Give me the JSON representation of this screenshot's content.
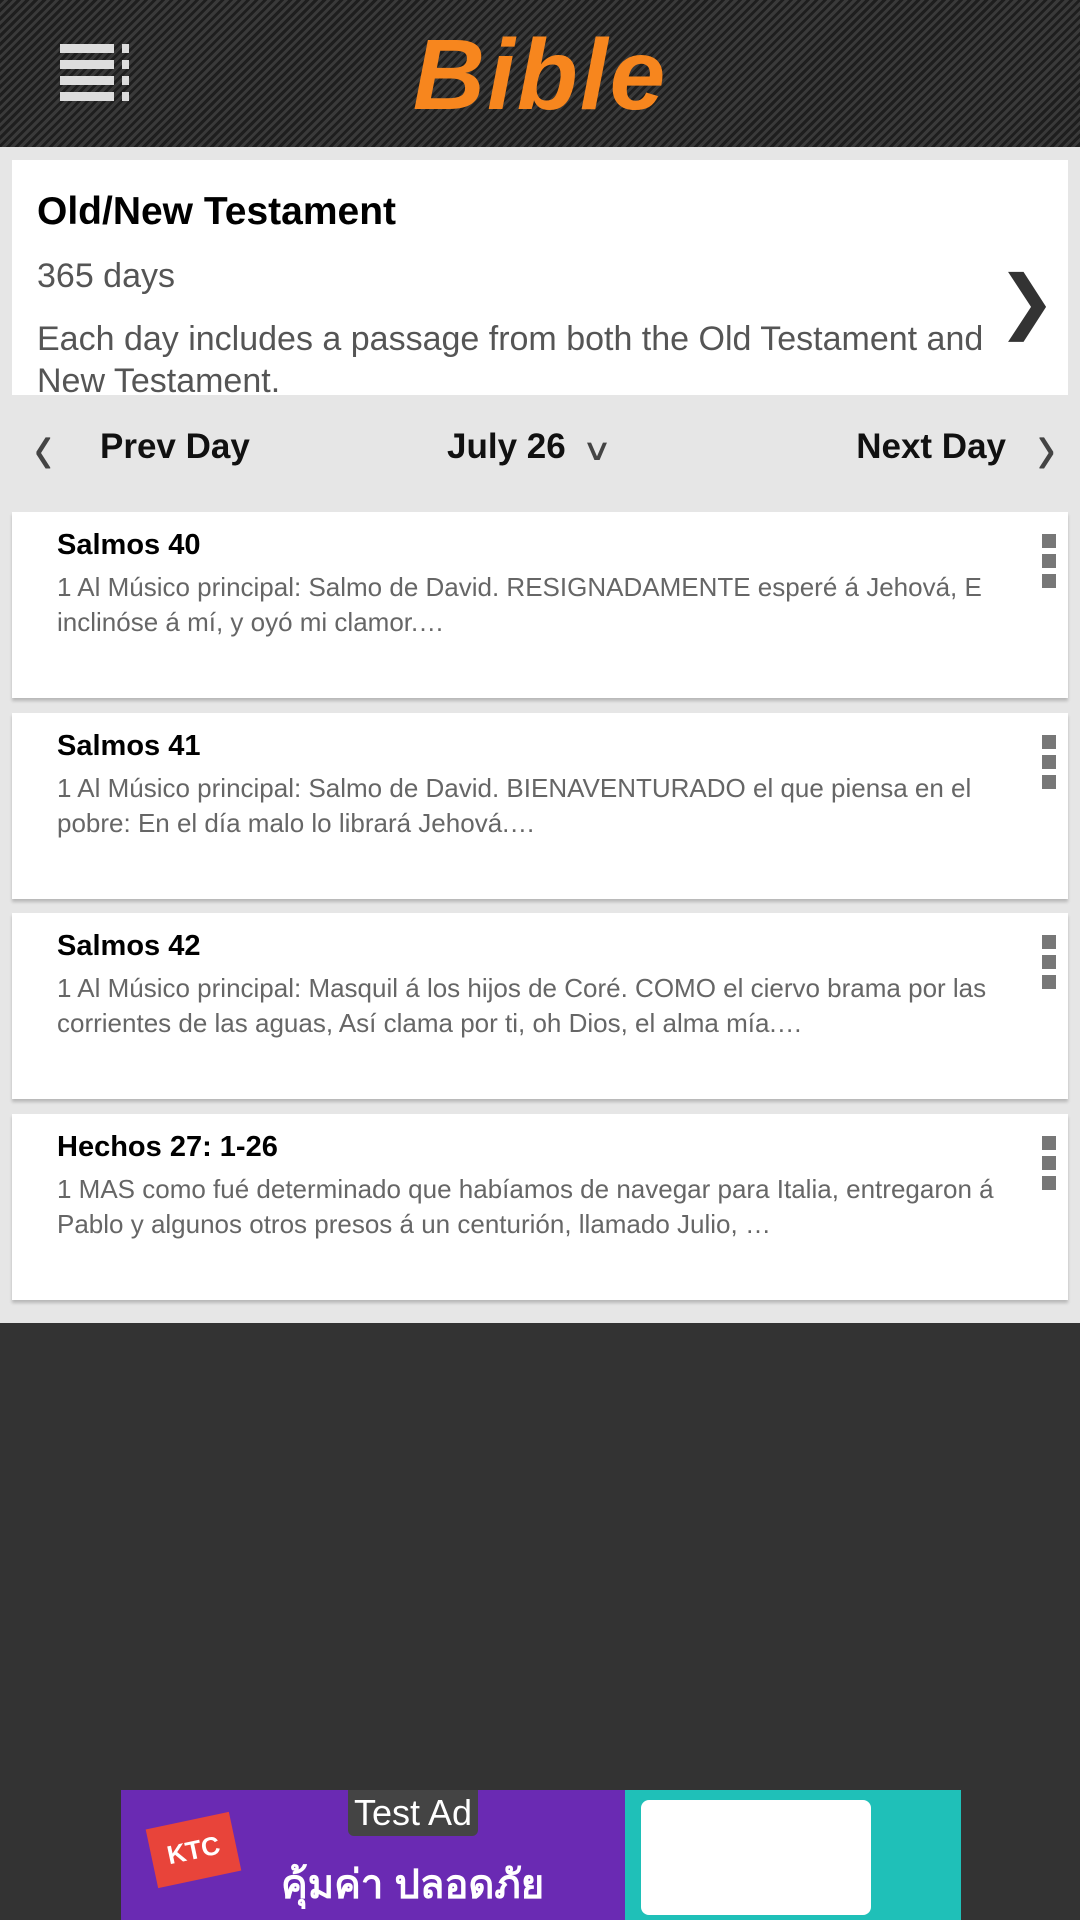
{
  "header": {
    "title": "Bible",
    "menu_icon": "list-menu-icon",
    "accent": "#f7861e"
  },
  "plan": {
    "title": "Old/New Testament",
    "duration": "365 days",
    "description": "Each day includes a passage from both the Old Testament and New Testament."
  },
  "nav": {
    "prev": "Prev Day",
    "date": "July 26",
    "next": "Next Day"
  },
  "readings": [
    {
      "title": "Salmos 40",
      "text": "1 Al Músico principal: Salmo de David. RESIGNADAMENTE esperé á Jehová, E inclinóse á mí, y oyó mi clamor.…"
    },
    {
      "title": "Salmos 41",
      "text": "1 Al Músico principal: Salmo de David. BIENAVENTURADO el que piensa en el pobre: En el día malo lo librará Jehová.…"
    },
    {
      "title": "Salmos 42",
      "text": "1 Al Músico principal: Masquil á los hijos de Coré. COMO el ciervo brama por las corrientes de las aguas, Así clama por ti, oh Dios, el alma mía.…"
    },
    {
      "title": "Hechos 27: 1-26",
      "text": "1 MAS como fué determinado que habíamos de navegar para Italia, entregaron á Pablo y algunos otros presos á un centurión, llamado Julio, …"
    }
  ],
  "ad": {
    "label": "Test Ad",
    "brand": "KTC",
    "headline": "คุ้มค่า ปลอดภัย"
  }
}
